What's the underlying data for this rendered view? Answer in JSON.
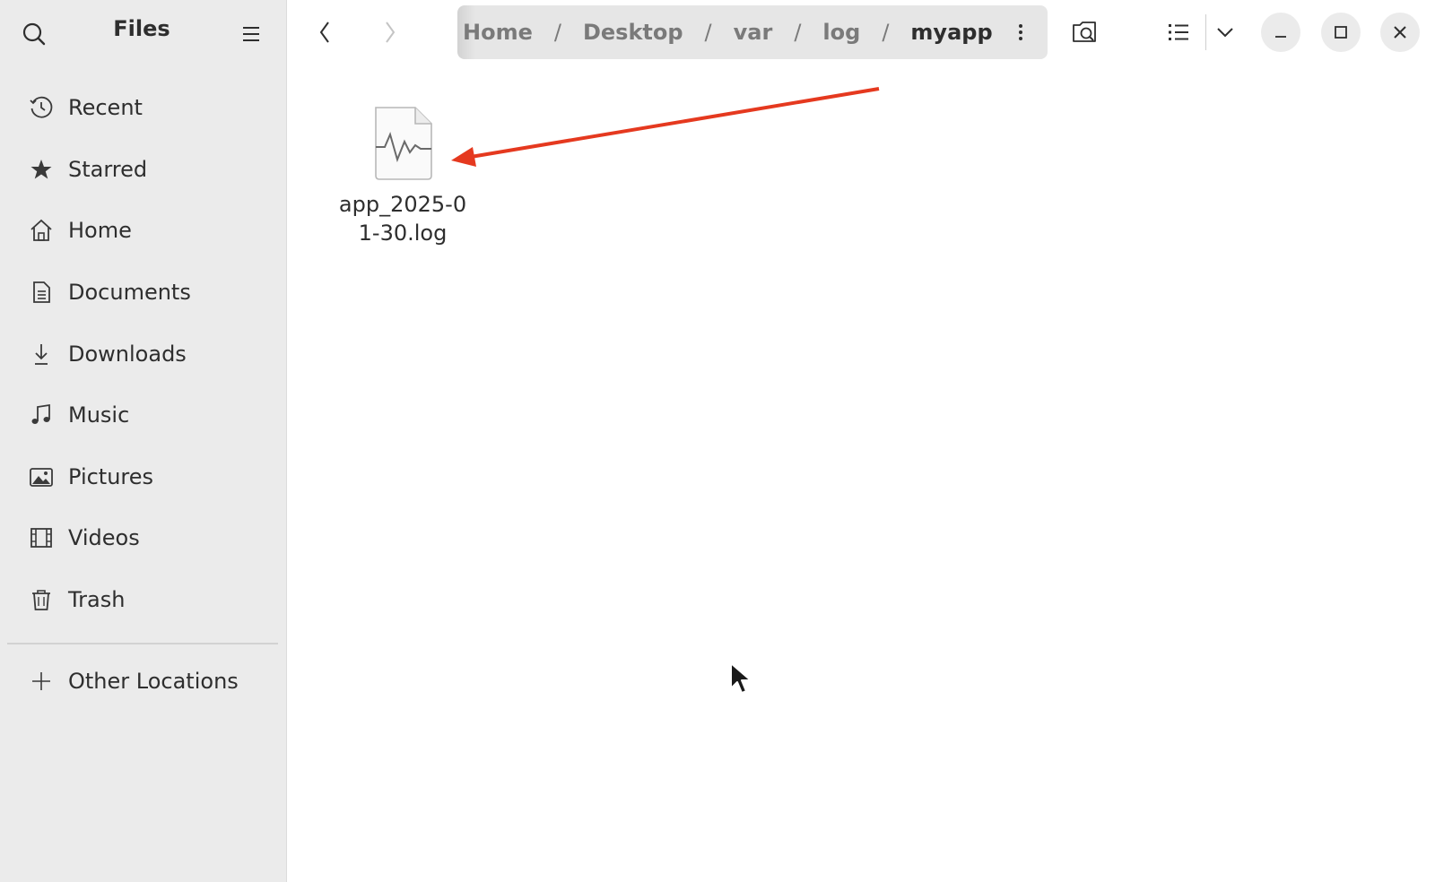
{
  "sidebar": {
    "title": "Files",
    "search_icon": "search-icon",
    "menu_icon": "hamburger-menu-icon",
    "items": [
      {
        "label": "Recent",
        "icon": "clock-icon"
      },
      {
        "label": "Starred",
        "icon": "star-icon"
      },
      {
        "label": "Home",
        "icon": "home-icon"
      },
      {
        "label": "Documents",
        "icon": "document-icon"
      },
      {
        "label": "Downloads",
        "icon": "download-icon"
      },
      {
        "label": "Music",
        "icon": "music-note-icon"
      },
      {
        "label": "Pictures",
        "icon": "picture-icon"
      },
      {
        "label": "Videos",
        "icon": "film-icon"
      },
      {
        "label": "Trash",
        "icon": "trash-icon"
      }
    ],
    "other_locations": {
      "label": "Other Locations",
      "icon": "plus-icon"
    }
  },
  "header": {
    "breadcrumbs": [
      "Home",
      "Desktop",
      "var",
      "log",
      "myapp"
    ],
    "separator": "/",
    "current": "myapp"
  },
  "content": {
    "files": [
      {
        "name": "app_2025-01-30.log",
        "icon": "log-file-icon"
      }
    ]
  },
  "colors": {
    "sidebar_bg": "#ebebeb",
    "pathbar_bg": "#e6e6e6",
    "annotation_arrow": "#e5391f",
    "text": "#2e2e2e"
  }
}
